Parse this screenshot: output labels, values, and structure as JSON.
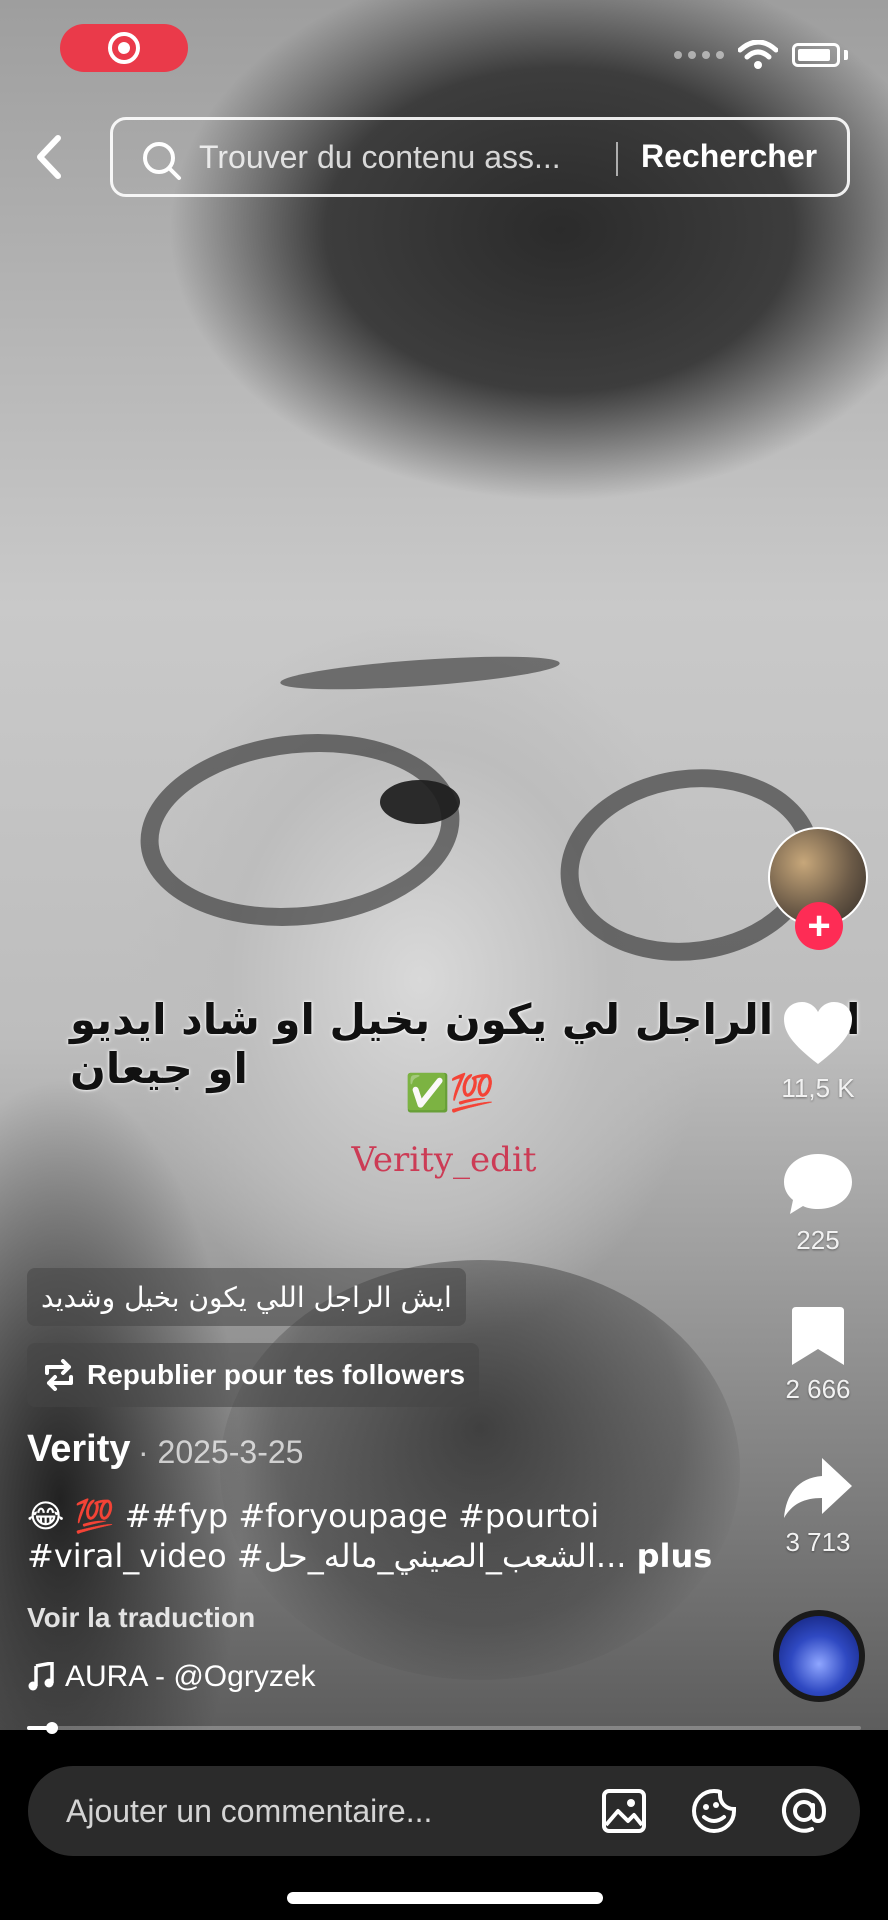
{
  "status_bar": {
    "recording_icon": "screen-record-icon",
    "signal_icon": "cellular-dots-icon",
    "wifi_icon": "wifi-icon",
    "battery_icon": "battery-icon"
  },
  "search": {
    "placeholder": "Trouver du contenu ass...",
    "button_label": "Rechercher"
  },
  "video_overlay": {
    "caption_arabic": "اتي الراجل لي يكون بخيل او شاد ايديو او جيعان",
    "caption_emoji": "✅💯",
    "watermark": "Verity_edit"
  },
  "actions": {
    "likes": "11,5 K",
    "comments": "225",
    "saves": "2 666",
    "shares": "3 713"
  },
  "post": {
    "overlay_label": "ايش الراجل اللي يكون بخيل وشديد",
    "repost_label": "Republier pour tes followers",
    "author": "Verity",
    "date": "· 2025-3-25",
    "description": "😂 💯  ##fyp #foryoupage #pourtoi #viral_video #الشعب_الصيني_ماله_حل... ",
    "more_label": "plus",
    "translate_label": "Voir la traduction",
    "music": "AURA - @Ogryzek",
    "progress": 0.03
  },
  "comment_bar": {
    "placeholder": "Ajouter un commentaire..."
  },
  "colors": {
    "accent": "#fe2c55",
    "watermark": "#cc3b55",
    "record": "#ea3a4a"
  }
}
